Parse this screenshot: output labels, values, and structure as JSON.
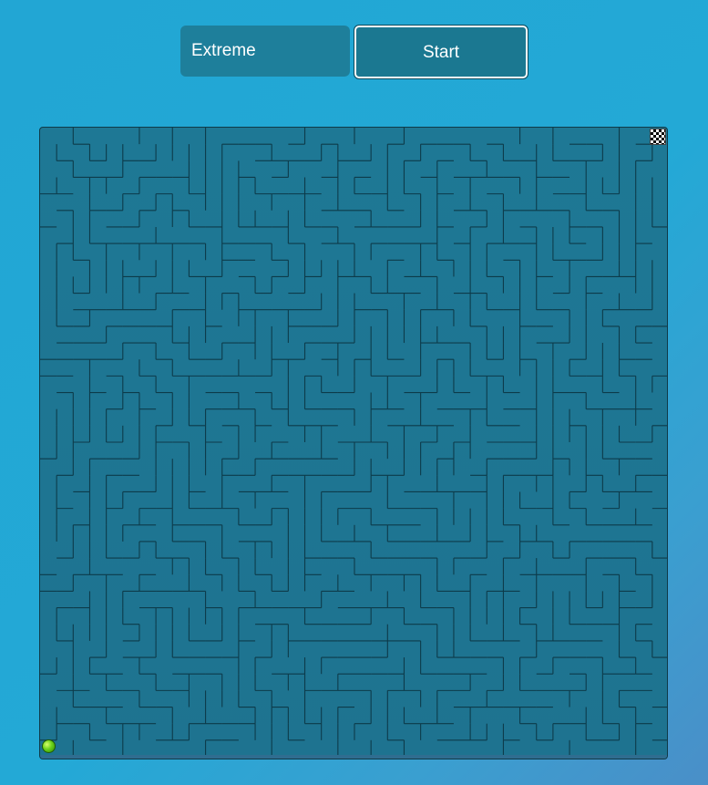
{
  "controls": {
    "difficulty_label": "Extreme",
    "start_label": "Start"
  },
  "maze": {
    "goal_icon": "checkered-flag-icon",
    "player_icon": "green-ball-icon",
    "colors": {
      "background": "#1e7895",
      "wall": "#0d3b4a",
      "player": "#6ad11a"
    }
  }
}
